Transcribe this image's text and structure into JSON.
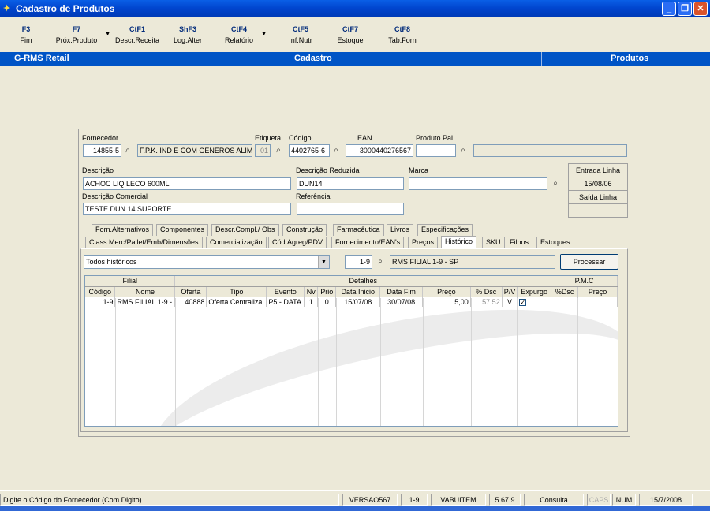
{
  "window": {
    "title": "Cadastro de Produtos"
  },
  "fkeys": [
    {
      "key": "F3",
      "label": "Fim"
    },
    {
      "key": "F7",
      "label": "Próx.Produto"
    },
    {
      "key": "CtF1",
      "label": "Descr.Receita"
    },
    {
      "key": "ShF3",
      "label": "Log.Alter"
    },
    {
      "key": "CtF4",
      "label": "Relatório"
    },
    {
      "key": "CtF5",
      "label": "Inf.Nutr"
    },
    {
      "key": "CtF7",
      "label": "Estoque"
    },
    {
      "key": "CtF8",
      "label": "Tab.Forn"
    }
  ],
  "header_bar": {
    "app": "G-RMS Retail",
    "section": "Cadastro",
    "module": "Produtos"
  },
  "form": {
    "fornecedor_label": "Fornecedor",
    "fornecedor_code": "14855-5",
    "fornecedor_name": "F.P.K. IND E COM GENEROS ALIM",
    "etiqueta_label": "Etiqueta",
    "etiqueta_value": "01",
    "codigo_label": "Código",
    "codigo_value": "4402765-6",
    "ean_label": "EAN",
    "ean_value": "3000440276567",
    "produto_pai_label": "Produto Pai",
    "produto_pai_value": "",
    "descricao_label": "Descrição",
    "descricao_value": "ACHOC LIQ LECO 600ML",
    "descricao_reduzida_label": "Descrição Reduzida",
    "descricao_reduzida_value": "DUN14",
    "marca_label": "Marca",
    "marca_value": "",
    "descricao_comercial_label": "Descrição Comercial",
    "descricao_comercial_value": "TESTE DUN 14 SUPORTE",
    "referencia_label": "Referência",
    "referencia_value": "",
    "entrada_linha_label": "Entrada Linha",
    "entrada_linha_value": "15/08/06",
    "saida_linha_label": "Saída Linha",
    "saida_linha_value": ""
  },
  "tabs_row1": [
    "Forn.Alternativos",
    "Componentes",
    "Descr.Compl./ Obs",
    "Construção",
    "Farmacêutica",
    "Livros",
    "Especificações"
  ],
  "tabs_row2": [
    "Class.Merc/Pallet/Emb/Dimensões",
    "Comercialização",
    "Cód.Agreg/PDV",
    "Fornecimento/EAN's",
    "Preços",
    "Histórico",
    "SKU",
    "Filhos",
    "Estoques"
  ],
  "historico": {
    "filter_value": "Todos históricos",
    "filial_code": "1-9",
    "filial_name": "RMS FILIAL 1-9 - SP",
    "processar_label": "Processar",
    "group_headers": {
      "filial": "Filial",
      "detalhes": "Detalhes",
      "pmc": "P.M.C"
    },
    "columns": [
      "Código",
      "Nome",
      "Oferta",
      "Tipo",
      "Evento",
      "Nv",
      "Prio",
      "Data Inicio",
      "Data Fim",
      "Preço",
      "% Dsc",
      "P/V",
      "Expurgo",
      "%Dsc",
      "Preço"
    ],
    "rows": [
      [
        "1-9",
        "RMS FILIAL 1-9 -",
        "40888",
        "Oferta Centraliza",
        "P5 - DATA",
        "1",
        "0",
        "15/07/08",
        "30/07/08",
        "5,00",
        "57,52",
        "V",
        "✓",
        "",
        ""
      ]
    ]
  },
  "status": {
    "message": "Digite o Código do Fornecedor (Com Digito)",
    "version": "VERSAO567",
    "filial": "1-9",
    "table": "VABUITEM",
    "build": "5.67.9",
    "mode": "Consulta",
    "caps": "CAPS",
    "num": "NUM",
    "date": "15/7/2008"
  },
  "colors": {
    "title_blue": "#0054c6",
    "panel_bg": "#ece9d8"
  }
}
